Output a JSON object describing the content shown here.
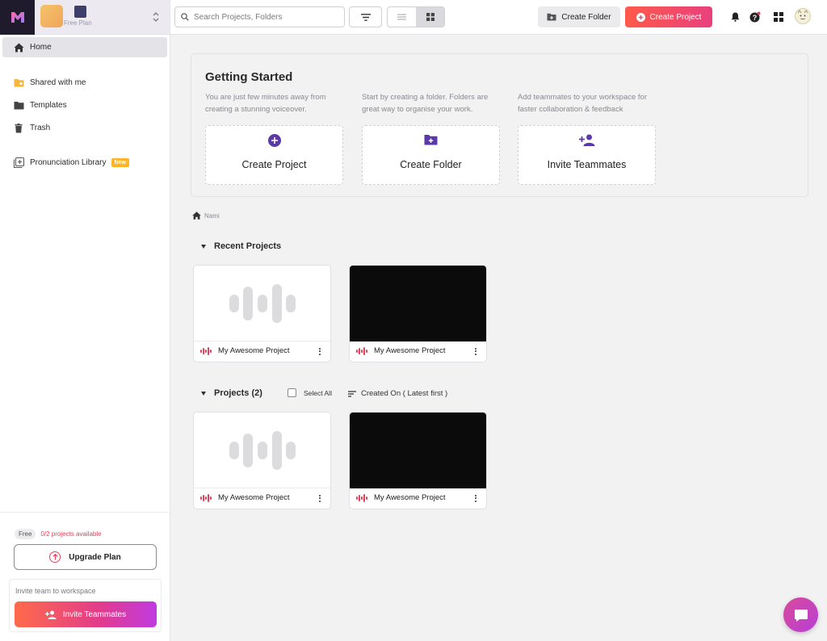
{
  "workspace": {
    "plan_label": "Free Plan"
  },
  "sidebar": {
    "items": [
      {
        "label": "Home",
        "icon": "home-icon"
      },
      {
        "label": "Shared with me",
        "icon": "shared-folder-icon"
      },
      {
        "label": "Templates",
        "icon": "folder-icon"
      },
      {
        "label": "Trash",
        "icon": "trash-icon"
      },
      {
        "label": "Pronunciation Library",
        "icon": "library-add-icon",
        "badge": "New"
      }
    ],
    "plan_chip": "Free",
    "projects_available": "0/2 projects available",
    "upgrade_label": "Upgrade Plan",
    "invite_text": "Invite team to workspace",
    "invite_button": "Invite Teammates"
  },
  "topbar": {
    "search_placeholder": "Search Projects, Folders",
    "create_folder": "Create Folder",
    "create_project": "Create Project"
  },
  "getting_started": {
    "title": "Getting Started",
    "cards": [
      {
        "desc": "You are just few minutes away from creating a stunning voiceover.",
        "label": "Create Project",
        "icon": "plus-circle-icon"
      },
      {
        "desc": "Start by creating a folder. Folders are great way to organise your work.",
        "label": "Create Folder",
        "icon": "folder-plus-icon"
      },
      {
        "desc": "Add teammates to your workspace for faster collaboration & feedback",
        "label": "Invite Teammates",
        "icon": "person-add-icon"
      }
    ]
  },
  "breadcrumb": "Nami",
  "recent": {
    "title": "Recent Projects",
    "items": [
      {
        "name": "My Awesome Project",
        "thumb": "placeholder"
      },
      {
        "name": "My Awesome Project",
        "thumb": "dark"
      }
    ]
  },
  "projects": {
    "title": "Projects (2)",
    "select_all": "Select All",
    "sort": "Created On ( Latest first )",
    "items": [
      {
        "name": "My Awesome Project",
        "thumb": "placeholder"
      },
      {
        "name": "My Awesome Project",
        "thumb": "dark"
      }
    ]
  },
  "colors": {
    "accent": "#6a3fb5",
    "brand_gradient_start": "#ff5a4a",
    "brand_gradient_end": "#e8407e",
    "waveform": "#e3425b"
  }
}
